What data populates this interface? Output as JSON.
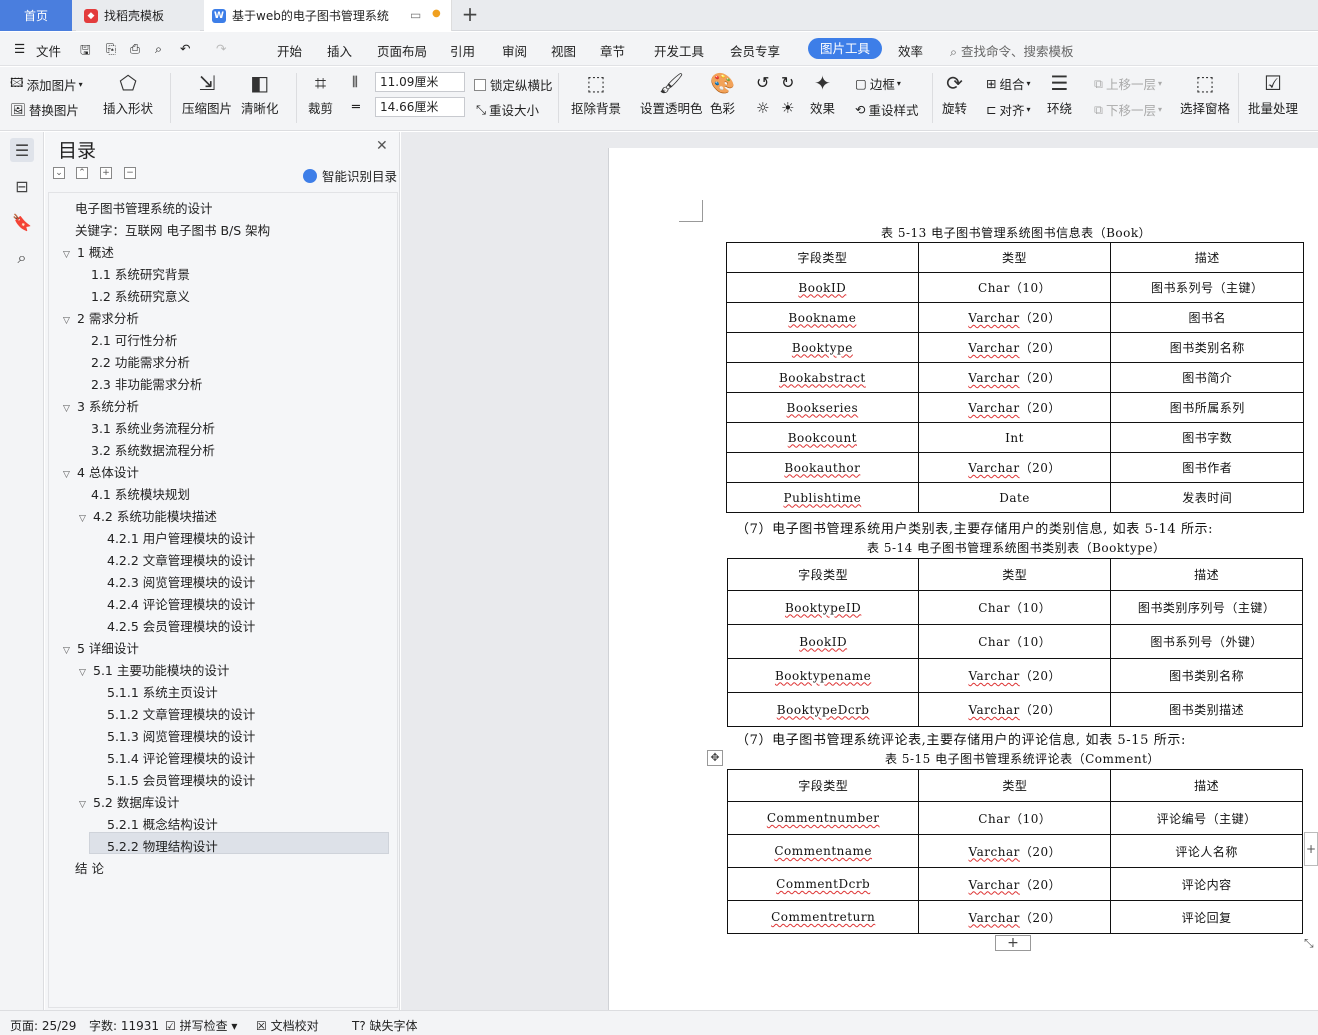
{
  "tabs": {
    "home": "首页",
    "template": "找稻壳模板",
    "doc": "基于web的电子图书管理系统"
  },
  "menu": {
    "file": "文件",
    "items": [
      "开始",
      "插入",
      "页面布局",
      "引用",
      "审阅",
      "视图",
      "章节",
      "开发工具",
      "会员专享"
    ],
    "active": "图片工具",
    "efficiency": "效率",
    "search": "查找命令、搜索模板"
  },
  "ribbon": {
    "add_pic": "添加图片",
    "replace_pic": "替换图片",
    "insert_shape": "插入形状",
    "compress": "压缩图片",
    "sharpen": "清晰化",
    "crop": "裁剪",
    "height": "11.09厘米",
    "width": "14.66厘米",
    "lock_ratio": "锁定纵横比",
    "reset_size": "重设大小",
    "remove_bg": "抠除背景",
    "set_transparent": "设置透明色",
    "color": "色彩",
    "effect": "效果",
    "border": "边框",
    "reset_style": "重设样式",
    "rotate": "旋转",
    "group": "组合",
    "align": "对齐",
    "wrap": "环绕",
    "up_layer": "上移一层",
    "down_layer": "下移一层",
    "select_pane": "选择窗格",
    "batch": "批量处理"
  },
  "toc": {
    "title": "目录",
    "smart": "智能识别目录",
    "items": [
      {
        "text": "电子图书管理系统的设计",
        "level": 0,
        "caret": ""
      },
      {
        "text": "关键字：互联网 电子图书 B/S 架构",
        "level": 0,
        "caret": ""
      },
      {
        "text": "1 概述",
        "level": 0,
        "caret": "v"
      },
      {
        "text": "1.1 系统研究背景",
        "level": 1,
        "caret": ""
      },
      {
        "text": "1.2 系统研究意义",
        "level": 1,
        "caret": ""
      },
      {
        "text": "2  需求分析",
        "level": 0,
        "caret": "v"
      },
      {
        "text": "2.1 可行性分析",
        "level": 1,
        "caret": ""
      },
      {
        "text": "2.2 功能需求分析",
        "level": 1,
        "caret": ""
      },
      {
        "text": "2.3 非功能需求分析",
        "level": 1,
        "caret": ""
      },
      {
        "text": "3 系统分析",
        "level": 0,
        "caret": "v"
      },
      {
        "text": "3.1 系统业务流程分析",
        "level": 1,
        "caret": ""
      },
      {
        "text": "3.2 系统数据流程分析",
        "level": 1,
        "caret": ""
      },
      {
        "text": "4 总体设计",
        "level": 0,
        "caret": "v"
      },
      {
        "text": "4.1 系统模块规划",
        "level": 1,
        "caret": ""
      },
      {
        "text": "4.2 系统功能模块描述",
        "level": 1,
        "caret": "v"
      },
      {
        "text": "4.2.1 用户管理模块的设计",
        "level": 2,
        "caret": ""
      },
      {
        "text": "4.2.2 文章管理模块的设计",
        "level": 2,
        "caret": ""
      },
      {
        "text": "4.2.3 阅览管理模块的设计",
        "level": 2,
        "caret": ""
      },
      {
        "text": "4.2.4 评论管理模块的设计",
        "level": 2,
        "caret": ""
      },
      {
        "text": "4.2.5 会员管理模块的设计",
        "level": 2,
        "caret": ""
      },
      {
        "text": "5  详细设计",
        "level": 0,
        "caret": "v"
      },
      {
        "text": "5.1 主要功能模块的设计",
        "level": 1,
        "caret": "v"
      },
      {
        "text": "5.1.1 系统主页设计",
        "level": 2,
        "caret": ""
      },
      {
        "text": "5.1.2 文章管理模块的设计",
        "level": 2,
        "caret": ""
      },
      {
        "text": "5.1.3 阅览管理模块的设计",
        "level": 2,
        "caret": ""
      },
      {
        "text": "5.1.4 评论管理模块的设计",
        "level": 2,
        "caret": ""
      },
      {
        "text": "5.1.5 会员管理模块的设计",
        "level": 2,
        "caret": ""
      },
      {
        "text": "5.2 数据库设计",
        "level": 1,
        "caret": "v"
      },
      {
        "text": "5.2.1 概念结构设计",
        "level": 2,
        "caret": ""
      },
      {
        "text": "5.2.2 物理结构设计",
        "level": 2,
        "caret": ""
      },
      {
        "text": "结    论",
        "level": 0,
        "caret": ""
      }
    ],
    "selected_index": 26
  },
  "doc": {
    "cap1": "表 5-13  电子图书管理系统图书信息表（Book）",
    "header": [
      "字段类型",
      "类型",
      "描述"
    ],
    "table1": [
      [
        "BookID",
        "Char（10）",
        "图书系列号（主键）"
      ],
      [
        "Bookname",
        "Varchar（20）",
        "图书名"
      ],
      [
        "Booktype",
        "Varchar（20）",
        "图书类别名称"
      ],
      [
        "Bookabstract",
        "Varchar（20）",
        "图书简介"
      ],
      [
        "Bookseries",
        "Varchar（20）",
        "图书所属系列"
      ],
      [
        "Bookcount",
        "Int",
        "图书字数"
      ],
      [
        "Bookauthor",
        "Varchar（20）",
        "图书作者"
      ],
      [
        "Publishtime",
        "Date",
        "发表时间"
      ]
    ],
    "para1": "（7）电子图书管理系统用户类别表,主要存储用户的类别信息, 如表 5-14 所示:",
    "cap2": "表 5-14  电子图书管理系统图书类别表（Booktype）",
    "table2": [
      [
        "BooktypeID",
        "Char（10）",
        "图书类别序列号（主键）"
      ],
      [
        "BookID",
        "Char（10）",
        "图书系列号（外键）"
      ],
      [
        "Booktypename",
        "Varchar（20）",
        "图书类别名称"
      ],
      [
        "BooktypeDcrb",
        "Varchar（20）",
        "图书类别描述"
      ]
    ],
    "para2": "（7）电子图书管理系统评论表,主要存储用户的评论信息, 如表 5-15 所示:",
    "cap3": "表 5-15  电子图书管理系统评论表（Comment）",
    "table3": [
      [
        "Commentnumber",
        "Char（10）",
        "评论编号（主键）"
      ],
      [
        "Commentname",
        "Varchar（20）",
        "评论人名称"
      ],
      [
        "CommentDcrb",
        "Varchar（20）",
        "评论内容"
      ],
      [
        "Commentreturn",
        "Varchar（20）",
        "评论回复"
      ]
    ]
  },
  "status": {
    "page": "页面: 25/29",
    "words": "字数: 11931",
    "spell": "拼写检查",
    "proof": "文档校对",
    "missing_font": "缺失字体"
  },
  "colors": {
    "accent": "#3d7ee8",
    "home_tab": "#4a7ede",
    "selection": "#dde1e8"
  }
}
